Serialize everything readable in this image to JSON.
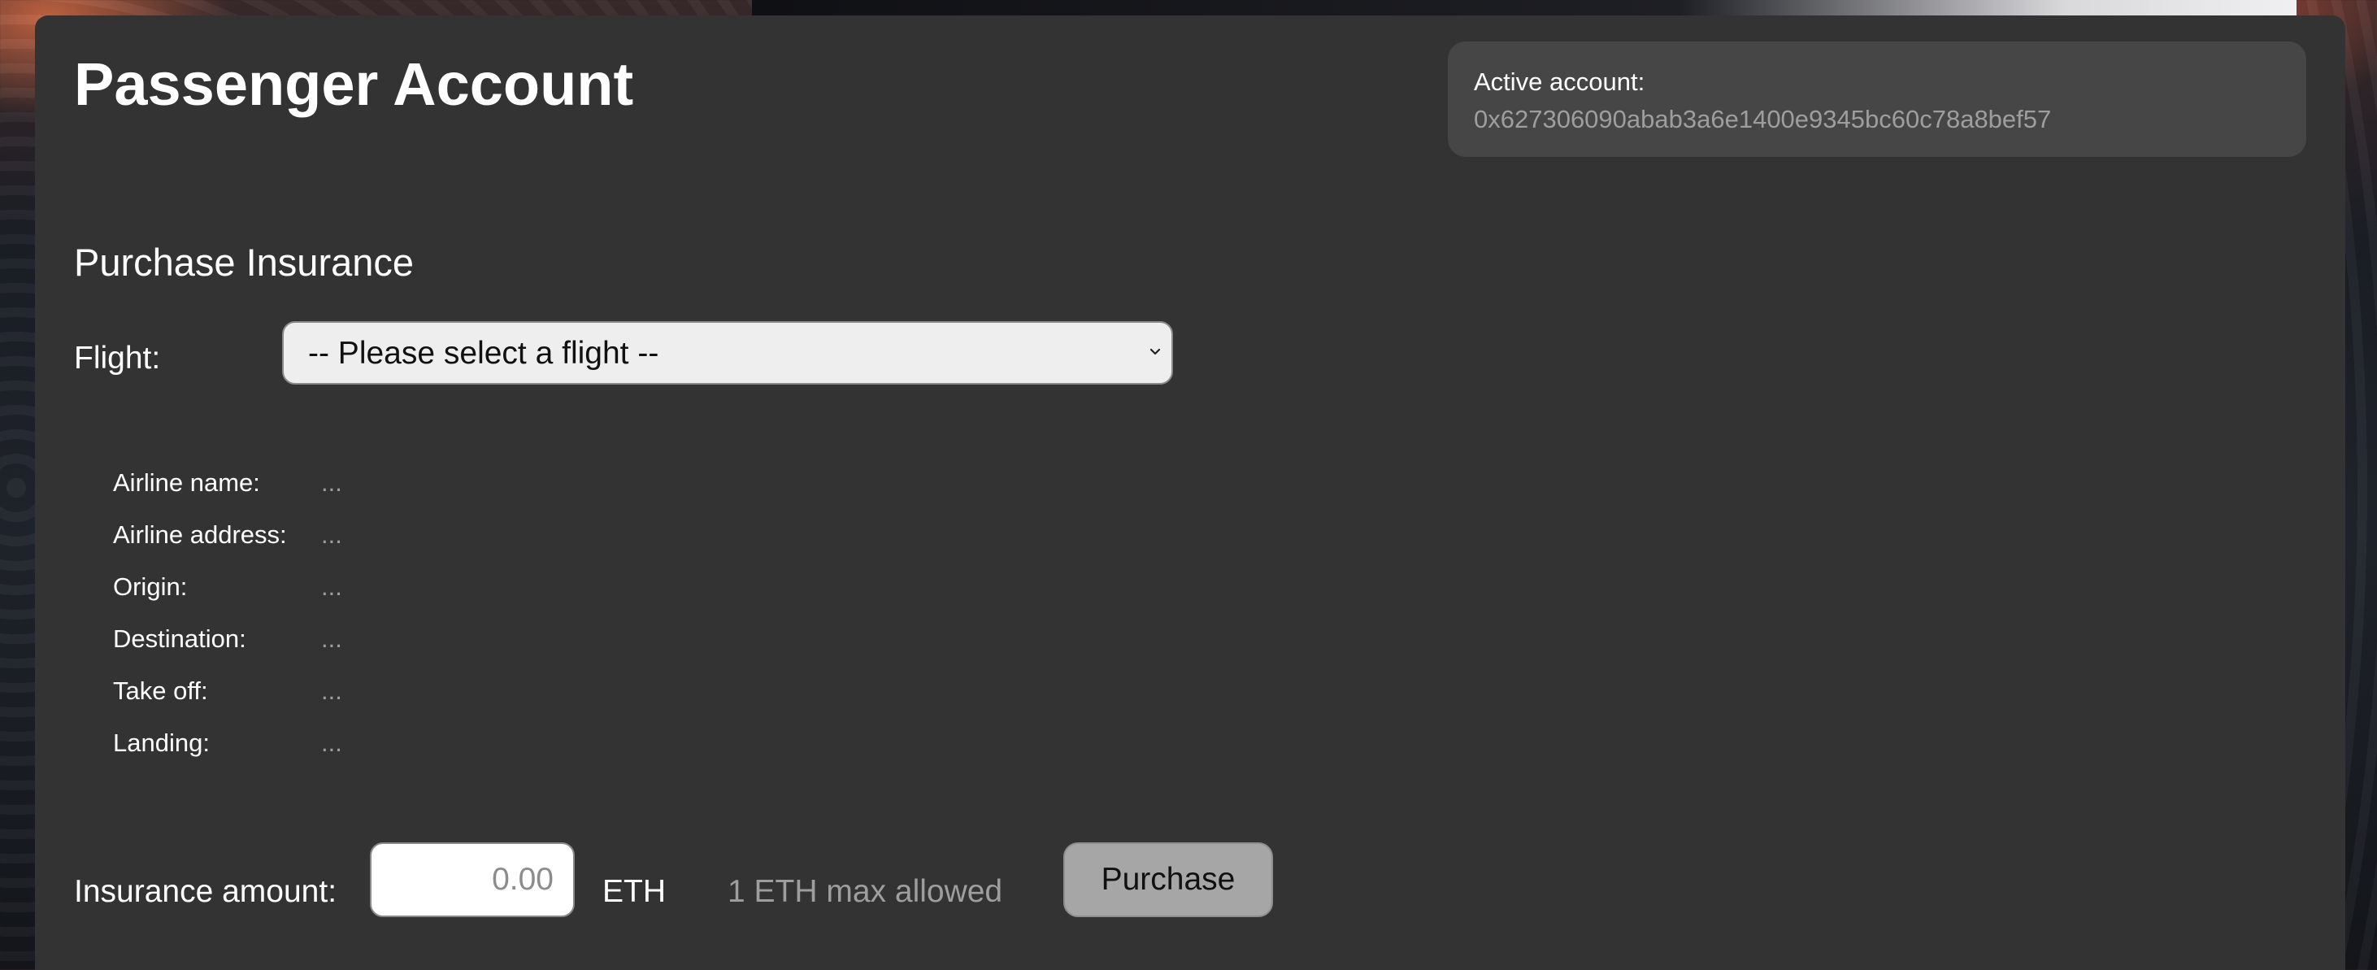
{
  "header": {
    "title": "Passenger Account"
  },
  "account": {
    "label": "Active account:",
    "address": "0x627306090abab3a6e1400e9345bc60c78a8bef57"
  },
  "purchase": {
    "section_title": "Purchase Insurance",
    "flight_label": "Flight:",
    "flight_select_value": "-- Please select a flight --",
    "details": [
      {
        "label": "Airline name:",
        "value": "..."
      },
      {
        "label": "Airline address:",
        "value": "..."
      },
      {
        "label": "Origin:",
        "value": "..."
      },
      {
        "label": "Destination:",
        "value": "..."
      },
      {
        "label": "Take off:",
        "value": "..."
      },
      {
        "label": "Landing:",
        "value": "..."
      }
    ],
    "amount_label": "Insurance amount:",
    "amount_placeholder": "0.00",
    "unit": "ETH",
    "max_note": "1 ETH max allowed",
    "button_label": "Purchase"
  },
  "icons": {
    "select_chevron": "chevron-down-icon"
  },
  "colors": {
    "panel_bg": "#333333",
    "account_box_bg": "#464646",
    "muted_text": "#9e9e9e",
    "button_bg": "#a6a6a6"
  }
}
